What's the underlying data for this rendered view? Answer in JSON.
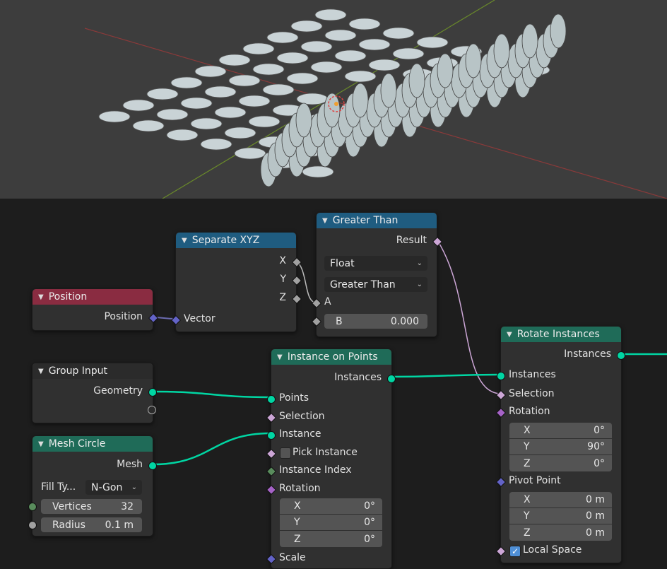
{
  "viewport": {
    "description_icon": "3d-viewport"
  },
  "nodes": {
    "position": {
      "title": "Position",
      "output": "Position"
    },
    "separate_xyz": {
      "title": "Separate XYZ",
      "out_x": "X",
      "out_y": "Y",
      "out_z": "Z",
      "input": "Vector"
    },
    "greater_than": {
      "title": "Greater Than",
      "output": "Result",
      "type": "Float",
      "operation": "Greater Than",
      "in_a": "A",
      "in_b_label": "B",
      "in_b_value": "0.000"
    },
    "group_input": {
      "title": "Group Input",
      "output": "Geometry"
    },
    "mesh_circle": {
      "title": "Mesh Circle",
      "output": "Mesh",
      "fill_label": "Fill Ty...",
      "fill_value": "N-Gon",
      "vertices_label": "Vertices",
      "vertices_value": "32",
      "radius_label": "Radius",
      "radius_value": "0.1 m"
    },
    "instance_on_points": {
      "title": "Instance on Points",
      "output": "Instances",
      "points": "Points",
      "selection": "Selection",
      "instance": "Instance",
      "pick_instance": "Pick Instance",
      "instance_index": "Instance Index",
      "rotation": "Rotation",
      "rot_x_label": "X",
      "rot_x": "0°",
      "rot_y_label": "Y",
      "rot_y": "0°",
      "rot_z_label": "Z",
      "rot_z": "0°",
      "scale": "Scale"
    },
    "rotate_instances": {
      "title": "Rotate Instances",
      "output": "Instances",
      "instances": "Instances",
      "selection": "Selection",
      "rotation": "Rotation",
      "rot_x_label": "X",
      "rot_x": "0°",
      "rot_y_label": "Y",
      "rot_y": "90°",
      "rot_z_label": "Z",
      "rot_z": "0°",
      "pivot": "Pivot Point",
      "piv_x_label": "X",
      "piv_x": "0 m",
      "piv_y_label": "Y",
      "piv_y": "0 m",
      "piv_z_label": "Z",
      "piv_z": "0 m",
      "local_space": "Local Space"
    }
  },
  "colors": {
    "geometry": "#00d6a3",
    "vector": "#6363c7",
    "float": "#a1a1a1",
    "boolean": "#cca6d6",
    "input_header": "#8a2c41",
    "converter_header": "#1f5c80",
    "geometry_header": "#1f6b58"
  }
}
